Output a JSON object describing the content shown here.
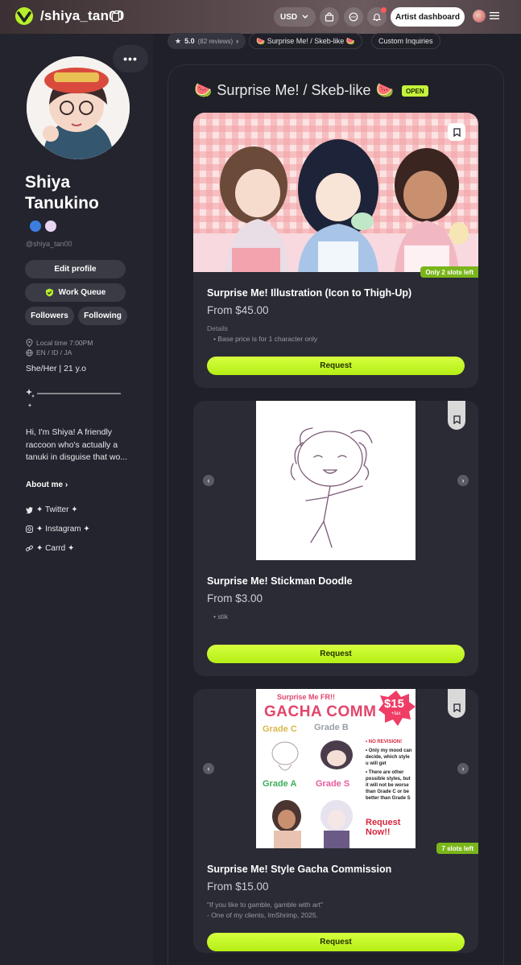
{
  "topbar": {
    "handle": "/shiya_tan00",
    "currency": "USD",
    "dashboard_label": "Artist dashboard"
  },
  "tabs": {
    "rating": "5.0",
    "reviews": "(82 reviews)",
    "surprise": "🍉 Surprise Me! / Skeb-like 🍉",
    "custom": "Custom Inquiries"
  },
  "profile": {
    "more_label": "•••",
    "name": "Shiya Tanukino",
    "at_handle": "@shiya_tan00",
    "edit_label": "Edit profile",
    "queue_label": "Work Queue",
    "followers_label": "Followers",
    "following_label": "Following",
    "local_time": "Local time 7:00PM",
    "languages": "EN / ID / JA",
    "pronouns": "She/Her | 21 y.o",
    "bio": "Hi, I'm Shiya! A friendly raccoon who's actually a tanuki in disguise that wo...",
    "about_label": "About me",
    "socials": [
      "✦ Twitter ✦",
      "✦ Instagram ✦",
      "✦ Carrd ✦"
    ]
  },
  "section": {
    "title_left": "🍉",
    "title": "Surprise Me! / Skeb-like",
    "title_right": "🍉",
    "badge": "OPEN"
  },
  "cards": [
    {
      "slots": "Only 2 slots left",
      "title": "Surprise Me! Illustration (Icon to Thigh-Up)",
      "price": "From $45.00",
      "details_label": "Details",
      "detail": "• Base price is for 1 character only",
      "request": "Request"
    },
    {
      "title": "Surprise Me! Stickman Doodle",
      "price": "From $3.00",
      "detail": "• stik",
      "request": "Request"
    },
    {
      "slots": "7 slots left",
      "title": "Surprise Me! Style Gacha Commission",
      "price": "From $15.00",
      "quote": "\"If you like to gamble, gamble with art\"",
      "quote_author": "- One of my clients, ImShrimp, 2025.",
      "request": "Request"
    }
  ],
  "gacha_art": {
    "headline": "Surprise Me FR!!",
    "title": "GACHA COMM",
    "price": "$15",
    "price_note": "+tax",
    "grades": [
      "Grade C",
      "Grade B",
      "Grade A",
      "Grade S"
    ],
    "notes": [
      "• NO REVISION!",
      "• Only my mood can decide, which style u will get",
      "• There are other possible styles, but it will not be worse than Grade C or be better than Grade S"
    ],
    "cta": "Request Now!!"
  },
  "colors": {
    "accent": "#c5f23a",
    "background": "#1f2028",
    "card": "#2a2b34"
  }
}
